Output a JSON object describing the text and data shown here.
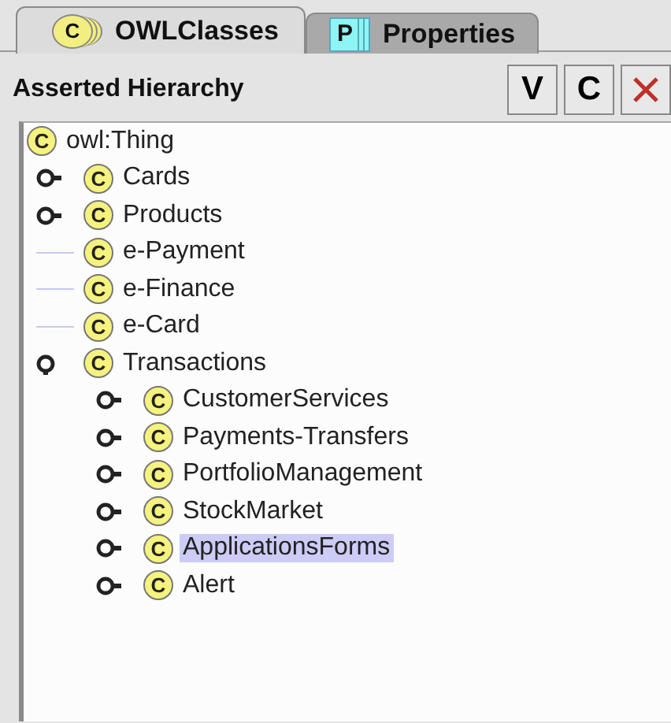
{
  "tabs": [
    {
      "icon_letter": "C",
      "kind": "class",
      "label": "OWLClasses",
      "selected": true
    },
    {
      "icon_letter": "P",
      "kind": "property",
      "label": "Properties",
      "selected": false
    }
  ],
  "header": {
    "title": "Asserted Hierarchy",
    "buttons": [
      {
        "kind": "text",
        "label": "V"
      },
      {
        "kind": "text",
        "label": "C"
      },
      {
        "kind": "delete"
      }
    ]
  },
  "tree": {
    "root": {
      "label": "owl:Thing",
      "badge": "C",
      "selected": false,
      "children": [
        {
          "label": "Cards",
          "badge": "C",
          "kind": "branch",
          "expanded": false,
          "selected": false
        },
        {
          "label": "Products",
          "badge": "C",
          "kind": "branch",
          "expanded": false,
          "selected": false
        },
        {
          "label": "e-Payment",
          "badge": "C",
          "kind": "leaf",
          "selected": false
        },
        {
          "label": "e-Finance",
          "badge": "C",
          "kind": "leaf",
          "selected": false
        },
        {
          "label": "e-Card",
          "badge": "C",
          "kind": "leaf",
          "selected": false
        },
        {
          "label": "Transactions",
          "badge": "C",
          "kind": "branch",
          "expanded": true,
          "selected": false,
          "children": [
            {
              "label": "CustomerServices",
              "badge": "C",
              "kind": "branch",
              "expanded": false,
              "selected": false
            },
            {
              "label": "Payments-Transfers",
              "badge": "C",
              "kind": "branch",
              "expanded": false,
              "selected": false
            },
            {
              "label": "PortfolioManagement",
              "badge": "C",
              "kind": "branch",
              "expanded": false,
              "selected": false
            },
            {
              "label": "StockMarket",
              "badge": "C",
              "kind": "branch",
              "expanded": false,
              "selected": false
            },
            {
              "label": "ApplicationsForms",
              "badge": "C",
              "kind": "branch",
              "expanded": false,
              "selected": true
            },
            {
              "label": "Alert",
              "badge": "C",
              "kind": "branch",
              "expanded": false,
              "selected": false
            }
          ]
        }
      ]
    }
  }
}
